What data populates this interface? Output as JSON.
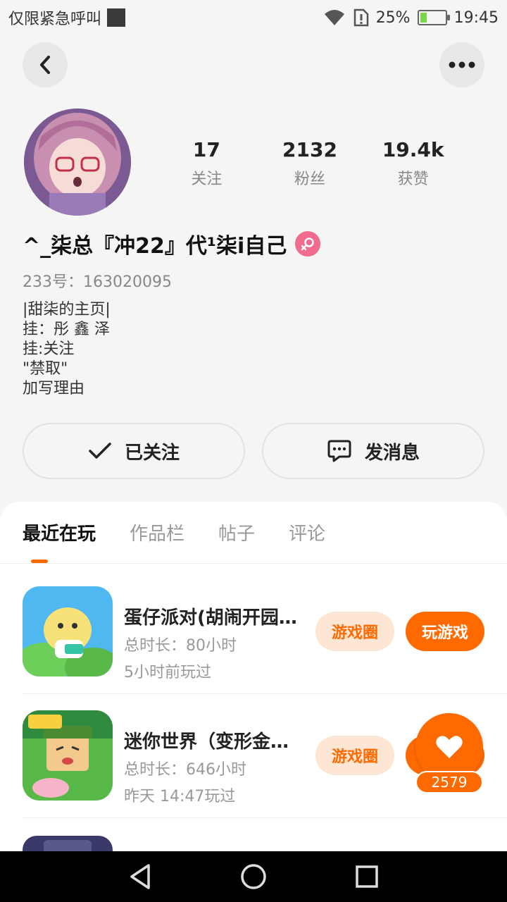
{
  "status_bar": {
    "carrier": "仅限紧急呼叫",
    "battery": "25%",
    "battery_level": 0.25,
    "time": "19:45"
  },
  "profile": {
    "stats": [
      {
        "value": "17",
        "label": "关注"
      },
      {
        "value": "2132",
        "label": "粉丝"
      },
      {
        "value": "19.4k",
        "label": "获赞"
      }
    ],
    "username": "^_柒总『冲22』代¹柒i自己",
    "user_id": "233号：163020095",
    "bio_lines": [
      "|甜柒的主页|",
      "挂：彤 鑫 泽",
      "挂:关注",
      "\"禁取\"",
      "加写理由"
    ]
  },
  "actions": {
    "follow_label": "已关注",
    "message_label": "发消息"
  },
  "tabs": [
    {
      "label": "最近在玩",
      "active": true
    },
    {
      "label": "作品栏",
      "active": false
    },
    {
      "label": "帖子",
      "active": false
    },
    {
      "label": "评论",
      "active": false
    }
  ],
  "games": [
    {
      "title": "蛋仔派对(胡闹开园…",
      "duration": "总时长：80小时",
      "last_played": "5小时前玩过",
      "circle_label": "游戏圈",
      "play_label": "玩游戏"
    },
    {
      "title": "迷你世界（变形金…",
      "duration": "总时长：646小时",
      "last_played": "昨天 14:47玩过",
      "circle_label": "游戏圈",
      "play_label": "玩游戏"
    }
  ],
  "like_float": {
    "count": "2579"
  },
  "colors": {
    "accent": "#ff6a00",
    "accent_light": "#fde6d4",
    "gender_badge": "#f06b8e"
  }
}
